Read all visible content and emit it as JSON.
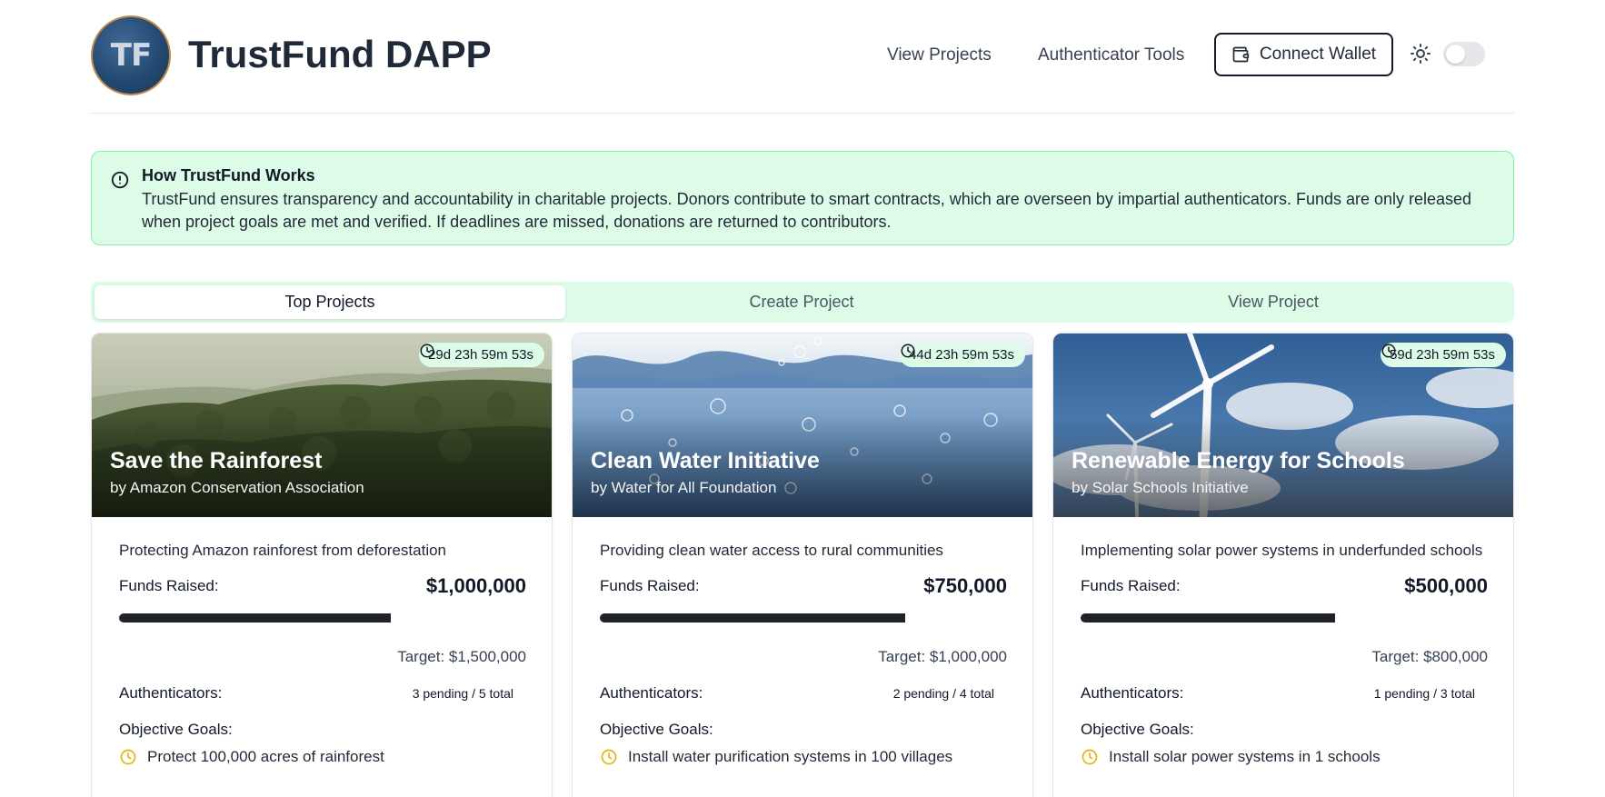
{
  "header": {
    "logo_text": "TF",
    "title": "TrustFund DAPP",
    "nav": [
      "View Projects",
      "Authenticator Tools"
    ],
    "connect_label": "Connect Wallet",
    "theme_toggle_on": false
  },
  "info": {
    "title": "How TrustFund Works",
    "text": "TrustFund ensures transparency and accountability in charitable projects. Donors contribute to smart contracts, which are overseen by impartial authenticators. Funds are only released when project goals are met and verified. If deadlines are missed, donations are returned to contributors."
  },
  "tabs": [
    "Top Projects",
    "Create Project",
    "View Project"
  ],
  "active_tab": "Top Projects",
  "labels": {
    "funds_raised": "Funds Raised:",
    "authenticators": "Authenticators:",
    "objective_goals": "Objective Goals:"
  },
  "colors": {
    "accent_green": "#dcfce7",
    "accent_border": "#86efac",
    "goal_icon": "#eab308",
    "progress": "#1f2328"
  },
  "projects": [
    {
      "title": "Save the Rainforest",
      "org": "by Amazon Conservation Association",
      "timer": "29d 23h 59m 53s",
      "description": "Protecting Amazon rainforest from deforestation",
      "funds": "$1,000,000",
      "target": "Target: $1,500,000",
      "progress": 0.667,
      "authenticators": "3 pending / 5 total",
      "goals": [
        "Protect 100,000 acres of rainforest"
      ],
      "image": "rainforest"
    },
    {
      "title": "Clean Water Initiative",
      "org": "by Water for All Foundation",
      "timer": "44d 23h 59m 53s",
      "description": "Providing clean water access to rural communities",
      "funds": "$750,000",
      "target": "Target: $1,000,000",
      "progress": 0.75,
      "authenticators": "2 pending / 4 total",
      "goals": [
        "Install water purification systems in 100 villages"
      ],
      "image": "water"
    },
    {
      "title": "Renewable Energy for Schools",
      "org": "by Solar Schools Initiative",
      "timer": "59d 23h 59m 53s",
      "description": "Implementing solar power systems in underfunded schools",
      "funds": "$500,000",
      "target": "Target: $800,000",
      "progress": 0.625,
      "authenticators": "1 pending / 3 total",
      "goals": [
        "Install solar power systems in 1 schools"
      ],
      "image": "wind"
    }
  ]
}
